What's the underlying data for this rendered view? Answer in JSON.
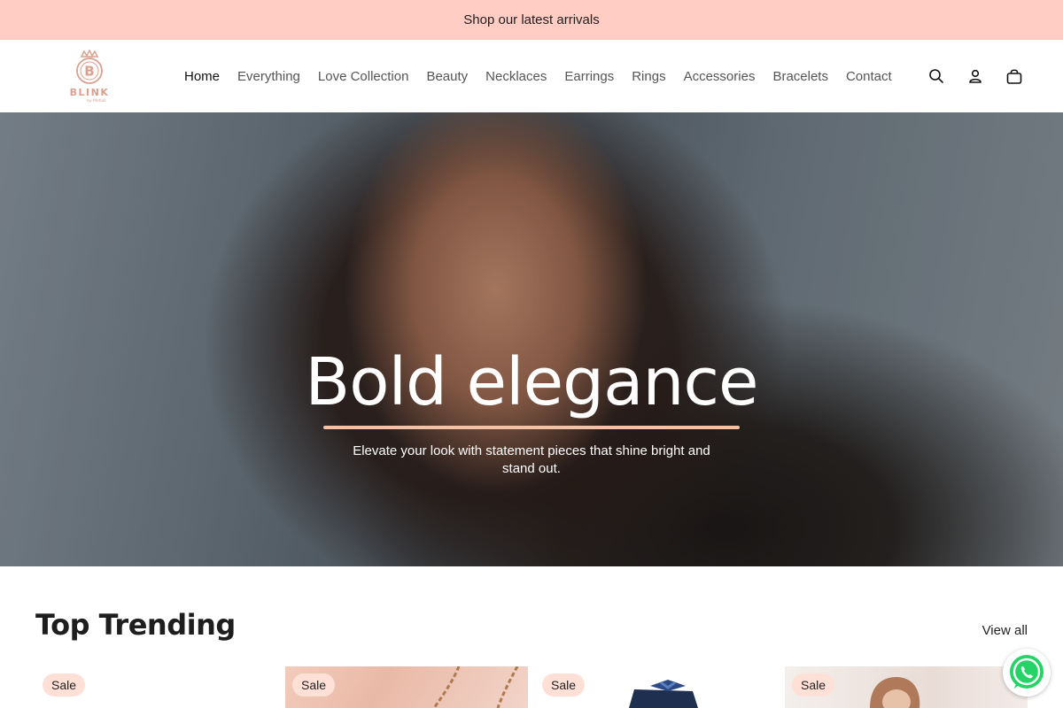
{
  "announcement": {
    "text": "Shop our latest arrivals"
  },
  "header": {
    "logo_text": "BLINK",
    "logo_subtext": "by Mehak",
    "nav": [
      {
        "label": "Home",
        "active": true
      },
      {
        "label": "Everything"
      },
      {
        "label": "Love Collection"
      },
      {
        "label": "Beauty"
      },
      {
        "label": "Necklaces"
      },
      {
        "label": "Earrings"
      },
      {
        "label": "Rings"
      },
      {
        "label": "Accessories"
      },
      {
        "label": "Bracelets"
      },
      {
        "label": "Contact"
      }
    ],
    "icons": [
      "search-icon",
      "account-icon",
      "cart-icon"
    ]
  },
  "hero": {
    "title": "Bold elegance",
    "subtitle": "Elevate your look with statement pieces that shine bright and stand out."
  },
  "trending": {
    "title": "Top Trending",
    "view_all": "View all",
    "cards": [
      {
        "badge": "Sale"
      },
      {
        "badge": "Sale"
      },
      {
        "badge": "Sale"
      },
      {
        "badge": "Sale"
      }
    ]
  },
  "colors": {
    "announcement_bg": "#ffcdc4",
    "accent_rule": "#f2c1a6",
    "badge_bg": "#ffe0d6",
    "whatsapp_green": "#25d366"
  },
  "floating": {
    "icon": "whatsapp-icon"
  }
}
